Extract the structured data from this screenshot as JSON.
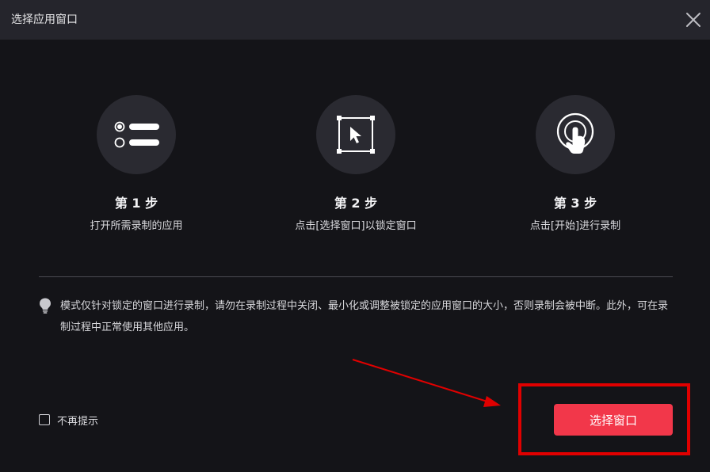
{
  "dialog": {
    "title": "选择应用窗口",
    "close_icon": "close-icon"
  },
  "steps": [
    {
      "label": "第 1 步",
      "desc": "打开所需录制的应用",
      "icon": "list-select-icon"
    },
    {
      "label": "第 2 步",
      "desc": "点击[选择窗口]以锁定窗口",
      "icon": "window-cursor-icon"
    },
    {
      "label": "第 3 步",
      "desc": "点击[开始]进行录制",
      "icon": "tap-hand-icon"
    }
  ],
  "tip": {
    "icon": "lightbulb-icon",
    "text": "模式仅针对锁定的窗口进行录制，请勿在录制过程中关闭、最小化或调整被锁定的应用窗口的大小，否则录制会被中断。此外，可在录制过程中正常使用其他应用。"
  },
  "footer": {
    "dont_show_label": "不再提示",
    "dont_show_checked": false,
    "select_window_label": "选择窗口"
  },
  "colors": {
    "background": "#141418",
    "titlebar": "#25252c",
    "accent": "#f2374a",
    "annotation": "#e00000"
  }
}
